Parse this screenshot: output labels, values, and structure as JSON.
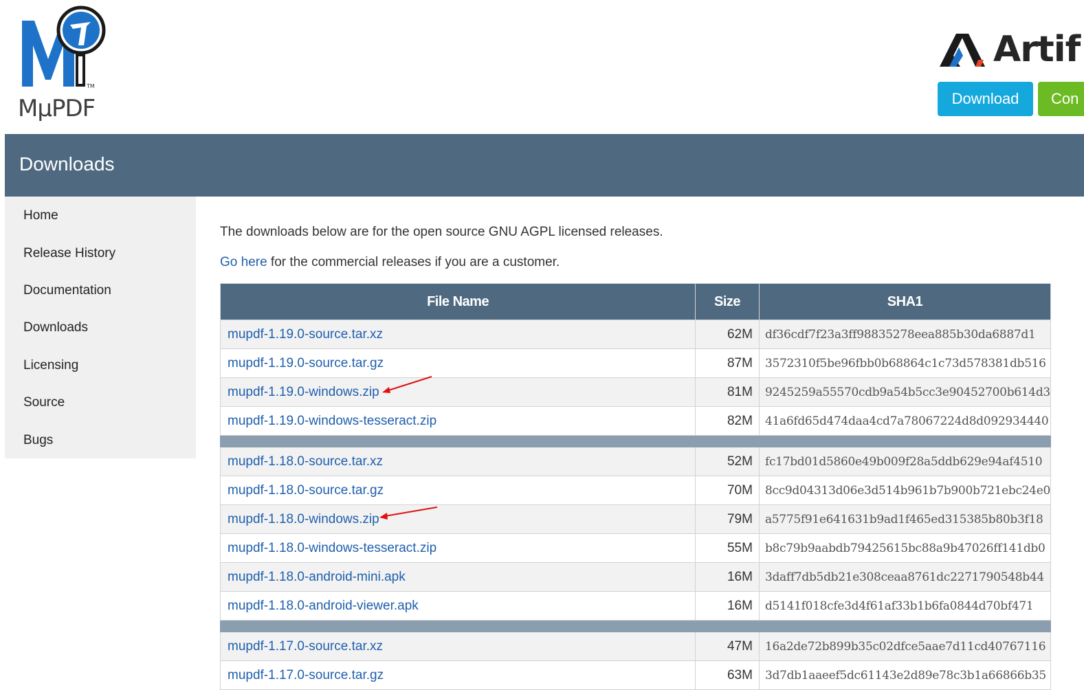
{
  "brand": {
    "logo_text": "MμPDF",
    "partner_name": "Artif"
  },
  "header_buttons": {
    "download": "Download",
    "contact": "Con"
  },
  "page_title": "Downloads",
  "sidebar": {
    "items": [
      {
        "label": "Home"
      },
      {
        "label": "Release History"
      },
      {
        "label": "Documentation"
      },
      {
        "label": "Downloads"
      },
      {
        "label": "Licensing"
      },
      {
        "label": "Source"
      },
      {
        "label": "Bugs"
      }
    ]
  },
  "intro": {
    "line1": "The downloads below are for the open source GNU AGPL licensed releases.",
    "link": "Go here",
    "line2_rest": " for the commercial releases if you are a customer."
  },
  "table": {
    "headers": {
      "name": "File Name",
      "size": "Size",
      "sha": "SHA1"
    },
    "groups": [
      [
        {
          "name": "mupdf-1.19.0-source.tar.xz",
          "size": "62M",
          "sha": "df36cdf7f23a3ff98835278eea885b30da6887d1"
        },
        {
          "name": "mupdf-1.19.0-source.tar.gz",
          "size": "87M",
          "sha": "3572310f5be96fbb0b68864c1c73d578381db516"
        },
        {
          "name": "mupdf-1.19.0-windows.zip",
          "size": "81M",
          "sha": "9245259a55570cdb9a54b5cc3e90452700b614d3",
          "arrow": true
        },
        {
          "name": "mupdf-1.19.0-windows-tesseract.zip",
          "size": "82M",
          "sha": "41a6fd65d474daa4cd7a78067224d8d092934440"
        }
      ],
      [
        {
          "name": "mupdf-1.18.0-source.tar.xz",
          "size": "52M",
          "sha": "fc17bd01d5860e49b009f28a5ddb629e94af4510"
        },
        {
          "name": "mupdf-1.18.0-source.tar.gz",
          "size": "70M",
          "sha": "8cc9d04313d06e3d514b961b7b900b721ebc24e0"
        },
        {
          "name": "mupdf-1.18.0-windows.zip",
          "size": "79M",
          "sha": "a5775f91e641631b9ad1f465ed315385b80b3f18",
          "arrow": true
        },
        {
          "name": "mupdf-1.18.0-windows-tesseract.zip",
          "size": "55M",
          "sha": "b8c79b9aabdb79425615bc88a9b47026ff141db0"
        },
        {
          "name": "mupdf-1.18.0-android-mini.apk",
          "size": "16M",
          "sha": "3daff7db5db21e308ceaa8761dc2271790548b44"
        },
        {
          "name": "mupdf-1.18.0-android-viewer.apk",
          "size": "16M",
          "sha": "d5141f018cfe3d4f61af33b1b6fa0844d70bf471"
        }
      ],
      [
        {
          "name": "mupdf-1.17.0-source.tar.xz",
          "size": "47M",
          "sha": "16a2de72b899b35c02dfce5aae7d11cd40767116"
        },
        {
          "name": "mupdf-1.17.0-source.tar.gz",
          "size": "63M",
          "sha": "3d7db1aaeef5dc61143e2d89e78c3b1a66866b35"
        }
      ]
    ]
  },
  "colors": {
    "header_bar": "#4f6a80",
    "link": "#1f5fae",
    "download_btn": "#15a8dd",
    "contact_btn": "#6dbb24",
    "annotation_arrow": "#e01010"
  }
}
